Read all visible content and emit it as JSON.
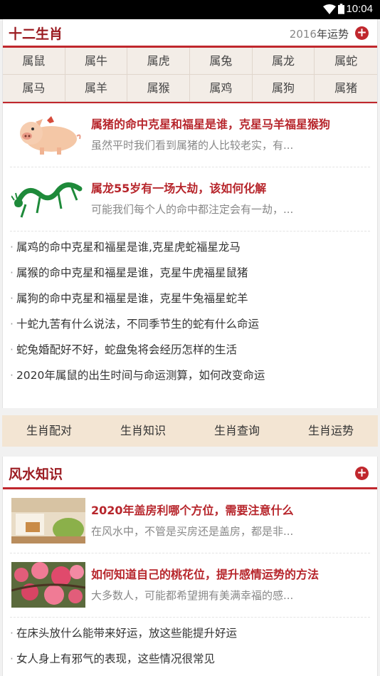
{
  "status": {
    "time": "10:04"
  },
  "zodiac_section": {
    "title": "十二生肖",
    "fortune_year": "2016",
    "fortune_label": "年运势",
    "animals": [
      "属鼠",
      "属牛",
      "属虎",
      "属兔",
      "属龙",
      "属蛇",
      "属马",
      "属羊",
      "属猴",
      "属鸡",
      "属狗",
      "属猪"
    ],
    "featured": [
      {
        "title": "属猪的命中克星和福星是谁，克星马羊福星猴狗",
        "desc": "虽然平时我们看到属猪的人比较老实，有..."
      },
      {
        "title": "属龙55岁有一场大劫，该如何化解",
        "desc": "可能我们每个人的命中都注定会有一劫，..."
      }
    ],
    "links": [
      "属鸡的命中克星和福星是谁,克星虎蛇福星龙马",
      "属猴的命中克星和福星是谁，克星牛虎福星鼠猪",
      "属狗的命中克星和福星是谁，克星牛兔福星蛇羊",
      "十蛇九苦有什么说法，不同季节生的蛇有什么命运",
      "蛇兔婚配好不好，蛇盘兔将会经历怎样的生活",
      "2020年属鼠的出生时间与命运测算，如何改变命运"
    ]
  },
  "tabs": [
    "生肖配对",
    "生肖知识",
    "生肖查询",
    "生肖运势"
  ],
  "fengshui_section": {
    "title": "风水知识",
    "featured": [
      {
        "title": "2020年盖房利哪个方位，需要注意什么",
        "desc": "在风水中，不管是买房还是盖房，都是非..."
      },
      {
        "title": "如何知道自己的桃花位，提升感情运势的方法",
        "desc": "大多数人，可能都希望拥有美满幸福的感..."
      }
    ],
    "links": [
      "在床头放什么能带来好运，放这些能提升好运",
      "女人身上有邪气的表现，这些情况很常见"
    ]
  },
  "colors": {
    "accent": "#c0272d",
    "title_red": "#b7262c",
    "tabs_bg": "#f3e5d3"
  }
}
